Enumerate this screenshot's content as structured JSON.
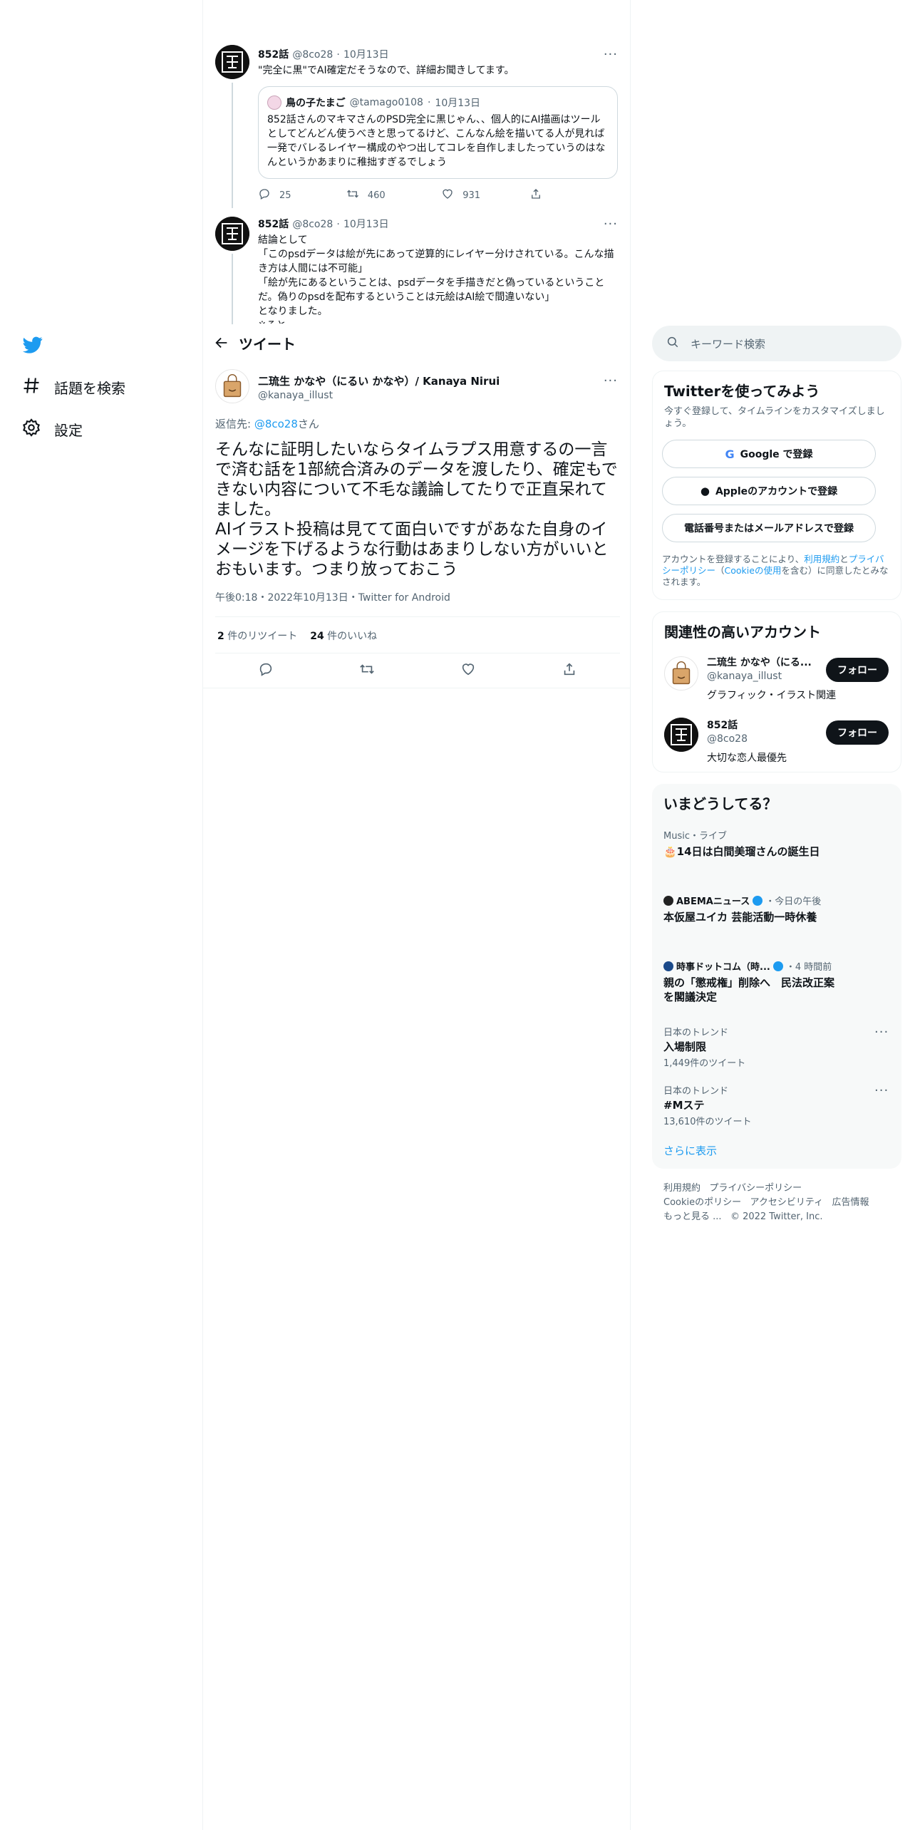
{
  "nav": {
    "explore_label": "話題を検索",
    "settings_label": "設定"
  },
  "thread": {
    "tweet1": {
      "name": "852話",
      "handle": "@8co28",
      "date": "10月13日",
      "text": "\"完全に黒\"でAI確定だそうなので、詳細お聞きしてます。",
      "quote": {
        "name": "鳥の子たまご",
        "handle": "@tamago0108",
        "date": "10月13日",
        "text": "852話さんのマキマさんのPSD完全に黒じゃん、、個人的にAI描画はツールとしてどんどん使うべきと思ってるけど、こんなん絵を描いてる人が見れば一発でバレるレイヤー構成のやつ出してコレを自作しましたっていうのはなんというかあまりに稚拙すぎるでしょう"
      },
      "replies": "25",
      "retweets": "460",
      "likes": "931"
    },
    "tweet2": {
      "name": "852話",
      "handle": "@8co28",
      "date": "10月13日",
      "text": "結論として\n「このpsdデータは絵が先にあって逆算的にレイヤー分けされている。こんな描き方は人間には不可能」\n「絵が先にあるということは、psdデータを手描きだと偽っているということだ。偽りのpsdを配布するということは元絵はAI絵で間違いない」\nとなりました。\n※ると"
    }
  },
  "header": {
    "title": "ツイート"
  },
  "main_tweet": {
    "name": "二琉生 かなや（にるい かなや）/ Kanaya Nirui",
    "handle": "@kanaya_illust",
    "reply_prefix": "返信先: ",
    "reply_to": "@8co28",
    "reply_suffix": "さん",
    "text": "そんなに証明したいならタイムラプス用意するの一言で済む話を1部統合済みのデータを渡したり、確定もできない内容について不毛な議論してたりで正直呆れてました。\nAIイラスト投稿は見てて面白いですがあなた自身のイメージを下げるような行動はあまりしない方がいいとおもいます。つまり放っておこう",
    "timestamp": "午後0:18・2022年10月13日・Twitter for Android",
    "retweet_count": "2",
    "retweet_label": "件のリツイート",
    "like_count": "24",
    "like_label": "件のいいね"
  },
  "search": {
    "placeholder": "キーワード検索"
  },
  "signup": {
    "title": "Twitterを使ってみよう",
    "subtitle": "今すぐ登録して、タイムラインをカスタマイズしましょう。",
    "google_label": "Google で登録",
    "apple_label": "Appleのアカウントで登録",
    "phone_label": "電話番号またはメールアドレスで登録",
    "legal_1": "アカウントを登録することにより、",
    "legal_terms": "利用規約",
    "legal_2": "と",
    "legal_privacy": "プライバシーポリシー",
    "legal_3": "（",
    "legal_cookie": "Cookieの使用",
    "legal_4": "を含む）に同意したとみなされます。"
  },
  "relevant": {
    "title": "関連性の高いアカウント",
    "accounts": [
      {
        "name": "二琉生 かなや（にる...",
        "handle": "@kanaya_illust",
        "bio": "グラフィック・イラスト関連",
        "follow_label": "フォロー"
      },
      {
        "name": "852話",
        "handle": "@8co28",
        "bio": "大切な恋人最優先",
        "follow_label": "フォロー"
      }
    ]
  },
  "trends": {
    "title": "いまどうしてる？",
    "items": [
      {
        "category": "Music・ライブ",
        "title": "🎂14日は白間美瑠さんの誕生日"
      },
      {
        "source": "ABEMAニュース",
        "time": "・今日の午後",
        "title": "本仮屋ユイカ 芸能活動一時休養"
      },
      {
        "source": "時事ドットコム（時...",
        "time": "・4 時間前",
        "title": "親の「懲戒権」削除へ　民法改正案を閣議決定"
      },
      {
        "category": "日本のトレンド",
        "title": "入場制限",
        "count": "1,449件のツイート"
      },
      {
        "category": "日本のトレンド",
        "title": "#Mステ",
        "count": "13,610件のツイート"
      }
    ],
    "show_more": "さらに表示"
  },
  "footer": {
    "terms": "利用規約",
    "privacy": "プライバシーポリシー",
    "cookie": "Cookieのポリシー",
    "accessibility": "アクセシビリティ",
    "ads": "広告情報",
    "more": "もっと見る ...",
    "copyright": "© 2022 Twitter, Inc."
  },
  "colors": {
    "accent": "#1d9bf0",
    "text": "#0f1419",
    "muted": "#536471"
  }
}
